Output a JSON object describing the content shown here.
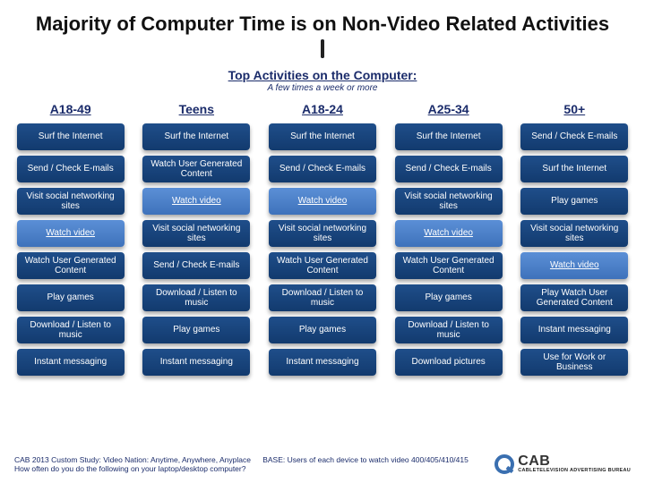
{
  "title": "Majority of Computer Time is on Non-Video Related Activities",
  "subtitle": "Top Activities on the Computer:",
  "subtitle_note": "A few times a week or more",
  "columns": [
    {
      "head": "A18-49",
      "items": [
        {
          "label": "Surf the Internet",
          "hl": false
        },
        {
          "label": "Send / Check E-mails",
          "hl": false
        },
        {
          "label": "Visit social networking sites",
          "hl": false
        },
        {
          "label": "Watch video",
          "hl": true
        },
        {
          "label": "Watch User Generated Content",
          "hl": false
        },
        {
          "label": "Play games",
          "hl": false
        },
        {
          "label": "Download / Listen to music",
          "hl": false
        },
        {
          "label": "Instant messaging",
          "hl": false
        }
      ]
    },
    {
      "head": "Teens",
      "items": [
        {
          "label": "Surf the Internet",
          "hl": false
        },
        {
          "label": "Watch User Generated Content",
          "hl": false
        },
        {
          "label": "Watch video",
          "hl": true
        },
        {
          "label": "Visit social networking sites",
          "hl": false
        },
        {
          "label": "Send / Check E-mails",
          "hl": false
        },
        {
          "label": "Download / Listen to music",
          "hl": false
        },
        {
          "label": "Play games",
          "hl": false
        },
        {
          "label": "Instant messaging",
          "hl": false
        }
      ]
    },
    {
      "head": "A18-24",
      "items": [
        {
          "label": "Surf the Internet",
          "hl": false
        },
        {
          "label": "Send / Check E-mails",
          "hl": false
        },
        {
          "label": "Watch video",
          "hl": true
        },
        {
          "label": "Visit social networking sites",
          "hl": false
        },
        {
          "label": "Watch User Generated Content",
          "hl": false
        },
        {
          "label": "Download / Listen to music",
          "hl": false
        },
        {
          "label": "Play games",
          "hl": false
        },
        {
          "label": "Instant messaging",
          "hl": false
        }
      ]
    },
    {
      "head": "A25-34",
      "items": [
        {
          "label": "Surf the Internet",
          "hl": false
        },
        {
          "label": "Send / Check E-mails",
          "hl": false
        },
        {
          "label": "Visit social networking sites",
          "hl": false
        },
        {
          "label": "Watch video",
          "hl": true
        },
        {
          "label": "Watch User Generated Content",
          "hl": false
        },
        {
          "label": "Play games",
          "hl": false
        },
        {
          "label": "Download / Listen to music",
          "hl": false
        },
        {
          "label": "Download pictures",
          "hl": false
        }
      ]
    },
    {
      "head": "50+",
      "items": [
        {
          "label": "Send / Check E-mails",
          "hl": false
        },
        {
          "label": "Surf the Internet",
          "hl": false
        },
        {
          "label": "Play games",
          "hl": false
        },
        {
          "label": "Visit social networking sites",
          "hl": false
        },
        {
          "label": "Watch video",
          "hl": true
        },
        {
          "label": "Play Watch User Generated Content",
          "hl": false
        },
        {
          "label": "Instant messaging",
          "hl": false
        },
        {
          "label": "Use for Work or Business",
          "hl": false
        }
      ]
    }
  ],
  "footnote": "CAB 2013 Custom Study: Video Nation: Anytime, Anywhere, Anyplace   BASE: Users of each device to watch video 400/405/410/415 How often do you do the following on your laptop/desktop computer?",
  "logo": {
    "text": "CAB",
    "tag": "CABLETELEVISION ADVERTISING BUREAU"
  }
}
